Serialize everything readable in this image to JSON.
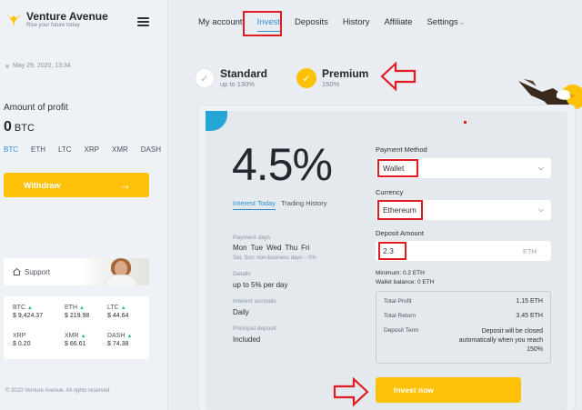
{
  "brand": {
    "name": "Venture Avenue",
    "tagline": "Rise your future today"
  },
  "sidebar": {
    "date": "May 29, 2020, 13:34",
    "profit_label": "Amount of profit",
    "profit_value": "0",
    "profit_currency": "BTC",
    "coin_tabs": [
      "BTC",
      "ETH",
      "LTC",
      "XRP",
      "XMR",
      "DASH"
    ],
    "withdraw_label": "Withdraw",
    "support_label": "Support",
    "tickers": [
      {
        "name": "BTC",
        "price": "$ 9,424.37",
        "trend": "up"
      },
      {
        "name": "ETH",
        "price": "$ 219.98",
        "trend": "up"
      },
      {
        "name": "LTC",
        "price": "$ 44.64",
        "trend": "up"
      },
      {
        "name": "XRP",
        "price": "$ 0.20",
        "trend": ""
      },
      {
        "name": "XMR",
        "price": "$ 66.61",
        "trend": "up"
      },
      {
        "name": "DASH",
        "price": "$ 74.38",
        "trend": "up"
      }
    ],
    "copyright": "© 2020 Venture Avenue. All rights reserved."
  },
  "nav": {
    "items": [
      "My account",
      "Invest",
      "Deposits",
      "History",
      "Affiliate",
      "Settings"
    ],
    "active": "Invest"
  },
  "plans": [
    {
      "name": "Standard",
      "sub": "up to 130%"
    },
    {
      "name": "Premium",
      "sub": "150%"
    }
  ],
  "plan_selected": "Premium",
  "invest": {
    "rate": "4.5%",
    "info_tabs": [
      "Interest Today",
      "Trading History"
    ],
    "payment_days_label": "Payment days",
    "payment_days": [
      "Mon",
      "Tue",
      "Wed",
      "Thu",
      "Fri"
    ],
    "payment_days_note": "Sat, Sun: non-business days – 0%",
    "details_label": "Details",
    "details_value": "up to 5% per day",
    "accruals_label": "Interest accruals",
    "accruals_value": "Daily",
    "principal_label": "Principal deposit",
    "principal_value": "Included",
    "payment_method_label": "Payment Method",
    "payment_method_value": "Wallet",
    "currency_label": "Currency",
    "currency_value": "Ethereum",
    "deposit_amount_label": "Deposit Amount",
    "deposit_amount_value": "2.3",
    "deposit_currency": "ETH",
    "minimum": "Minimum: 0.2 ETH",
    "wallet_balance": "Wallet balance: 0 ETH",
    "total_profit_label": "Total Profit",
    "total_profit_value": "1.15 ETH",
    "total_return_label": "Total Return",
    "total_return_value": "3.45 ETH",
    "deposit_term_label": "Deposit Term",
    "deposit_term_value": "Deposit will be closed automatically when you reach 150%",
    "invest_button": "Invest now"
  },
  "colors": {
    "accent": "#ffc107",
    "link": "#2f8fd4",
    "highlight": "#e01b22"
  }
}
